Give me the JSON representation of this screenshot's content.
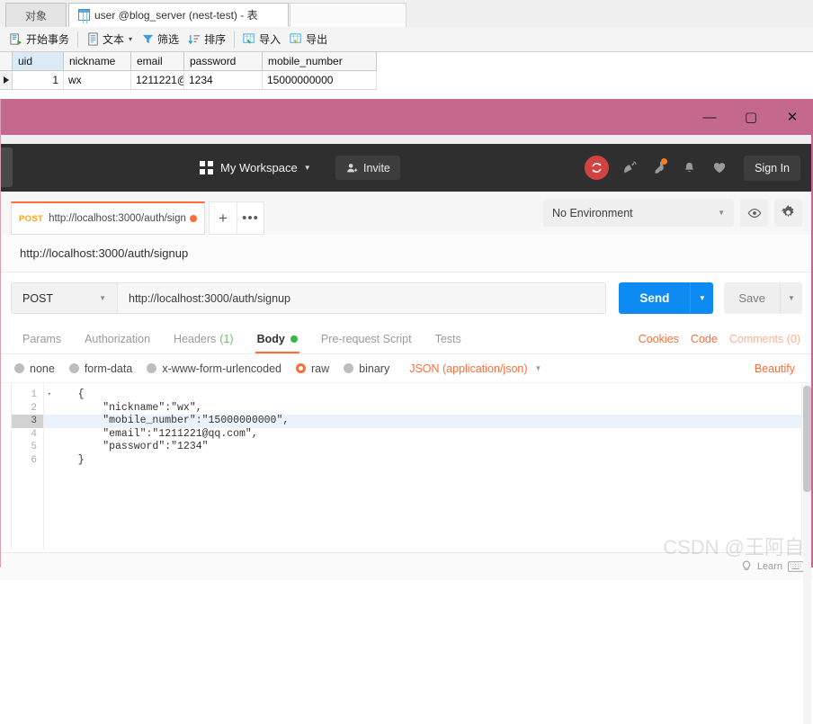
{
  "navicat": {
    "tabs": [
      {
        "label": "对象",
        "active": false,
        "icon": null
      },
      {
        "label": "user @blog_server (nest-test) - 表",
        "active": true,
        "icon": "table-grid-icon"
      },
      {
        "label": "",
        "active": false,
        "icon": null
      }
    ],
    "toolbar": [
      {
        "label": "开始事务",
        "icon": "transaction-icon"
      },
      {
        "label": "文本",
        "icon": "text-icon",
        "caret": "▾"
      },
      {
        "label": "筛选",
        "icon": "filter-icon"
      },
      {
        "label": "排序",
        "icon": "sort-icon"
      },
      {
        "label": "导入",
        "icon": "import-icon"
      },
      {
        "label": "导出",
        "icon": "export-icon"
      }
    ],
    "grid": {
      "columns": [
        "uid",
        "nickname",
        "email",
        "password",
        "mobile_number"
      ],
      "selected_column": "uid",
      "rows": [
        {
          "uid": "1",
          "nickname": "wx",
          "email": "1211221@",
          "password": "1234",
          "mobile_number": "15000000000"
        }
      ]
    }
  },
  "window": {
    "accent_color": "#c4698d",
    "controls": {
      "minimize": "—",
      "maximize": "▢",
      "close": "✕"
    }
  },
  "postman": {
    "header": {
      "workspace": "My Workspace",
      "workspace_caret": "▼",
      "invite_label": "Invite",
      "signin_label": "Sign In",
      "icons": [
        "sync-icon",
        "satellite-dish-icon",
        "rocket-icon",
        "bell-icon",
        "heart-icon"
      ]
    },
    "tabbar": {
      "request_tab": {
        "method": "POST",
        "url": "http://localhost:3000/auth/sign",
        "unsaved": true
      },
      "new_tab_label": "+",
      "more_label": "•••",
      "environment": "No Environment",
      "environment_caret": "▼",
      "eye_icon": "eye-icon",
      "gear_icon": "gear-icon"
    },
    "url_display": "http://localhost:3000/auth/signup",
    "request": {
      "method": "POST",
      "method_caret": "▼",
      "url": "http://localhost:3000/auth/signup",
      "send_label": "Send",
      "send_caret": "▼",
      "save_label": "Save",
      "save_caret": "▼"
    },
    "tabs": [
      {
        "label": "Params",
        "active": false
      },
      {
        "label": "Authorization",
        "active": false
      },
      {
        "label": "Headers",
        "count": "(1)",
        "active": false
      },
      {
        "label": "Body",
        "active": true,
        "dot": true
      },
      {
        "label": "Pre-request Script",
        "active": false
      },
      {
        "label": "Tests",
        "active": false
      }
    ],
    "right_links": [
      {
        "label": "Cookies",
        "muted": false
      },
      {
        "label": "Code",
        "muted": false
      },
      {
        "label": "Comments (0)",
        "muted": true
      }
    ],
    "body_types": [
      {
        "label": "none",
        "selected": false
      },
      {
        "label": "form-data",
        "selected": false
      },
      {
        "label": "x-www-form-urlencoded",
        "selected": false
      },
      {
        "label": "raw",
        "selected": true
      },
      {
        "label": "binary",
        "selected": false
      }
    ],
    "content_type": "JSON (application/json)",
    "content_type_caret": "▼",
    "beautify_label": "Beautify",
    "editor": {
      "gutter": [
        "1",
        "2",
        "3",
        "4",
        "5",
        "6"
      ],
      "fold_marker": "▾",
      "current_line": 3,
      "lines": [
        "    {",
        "        \"nickname\":\"wx\",",
        "        \"mobile_number\":\"15000000000\",",
        "        \"email\":\"1211221@qq.com\",",
        "        \"password\":\"1234\"",
        "    }"
      ]
    },
    "footer": {
      "bulb_icon": "lightbulb-icon",
      "learn_label": "Learn",
      "keyboard_icon": "keyboard-icon"
    }
  },
  "watermark": "CSDN @王阿自"
}
